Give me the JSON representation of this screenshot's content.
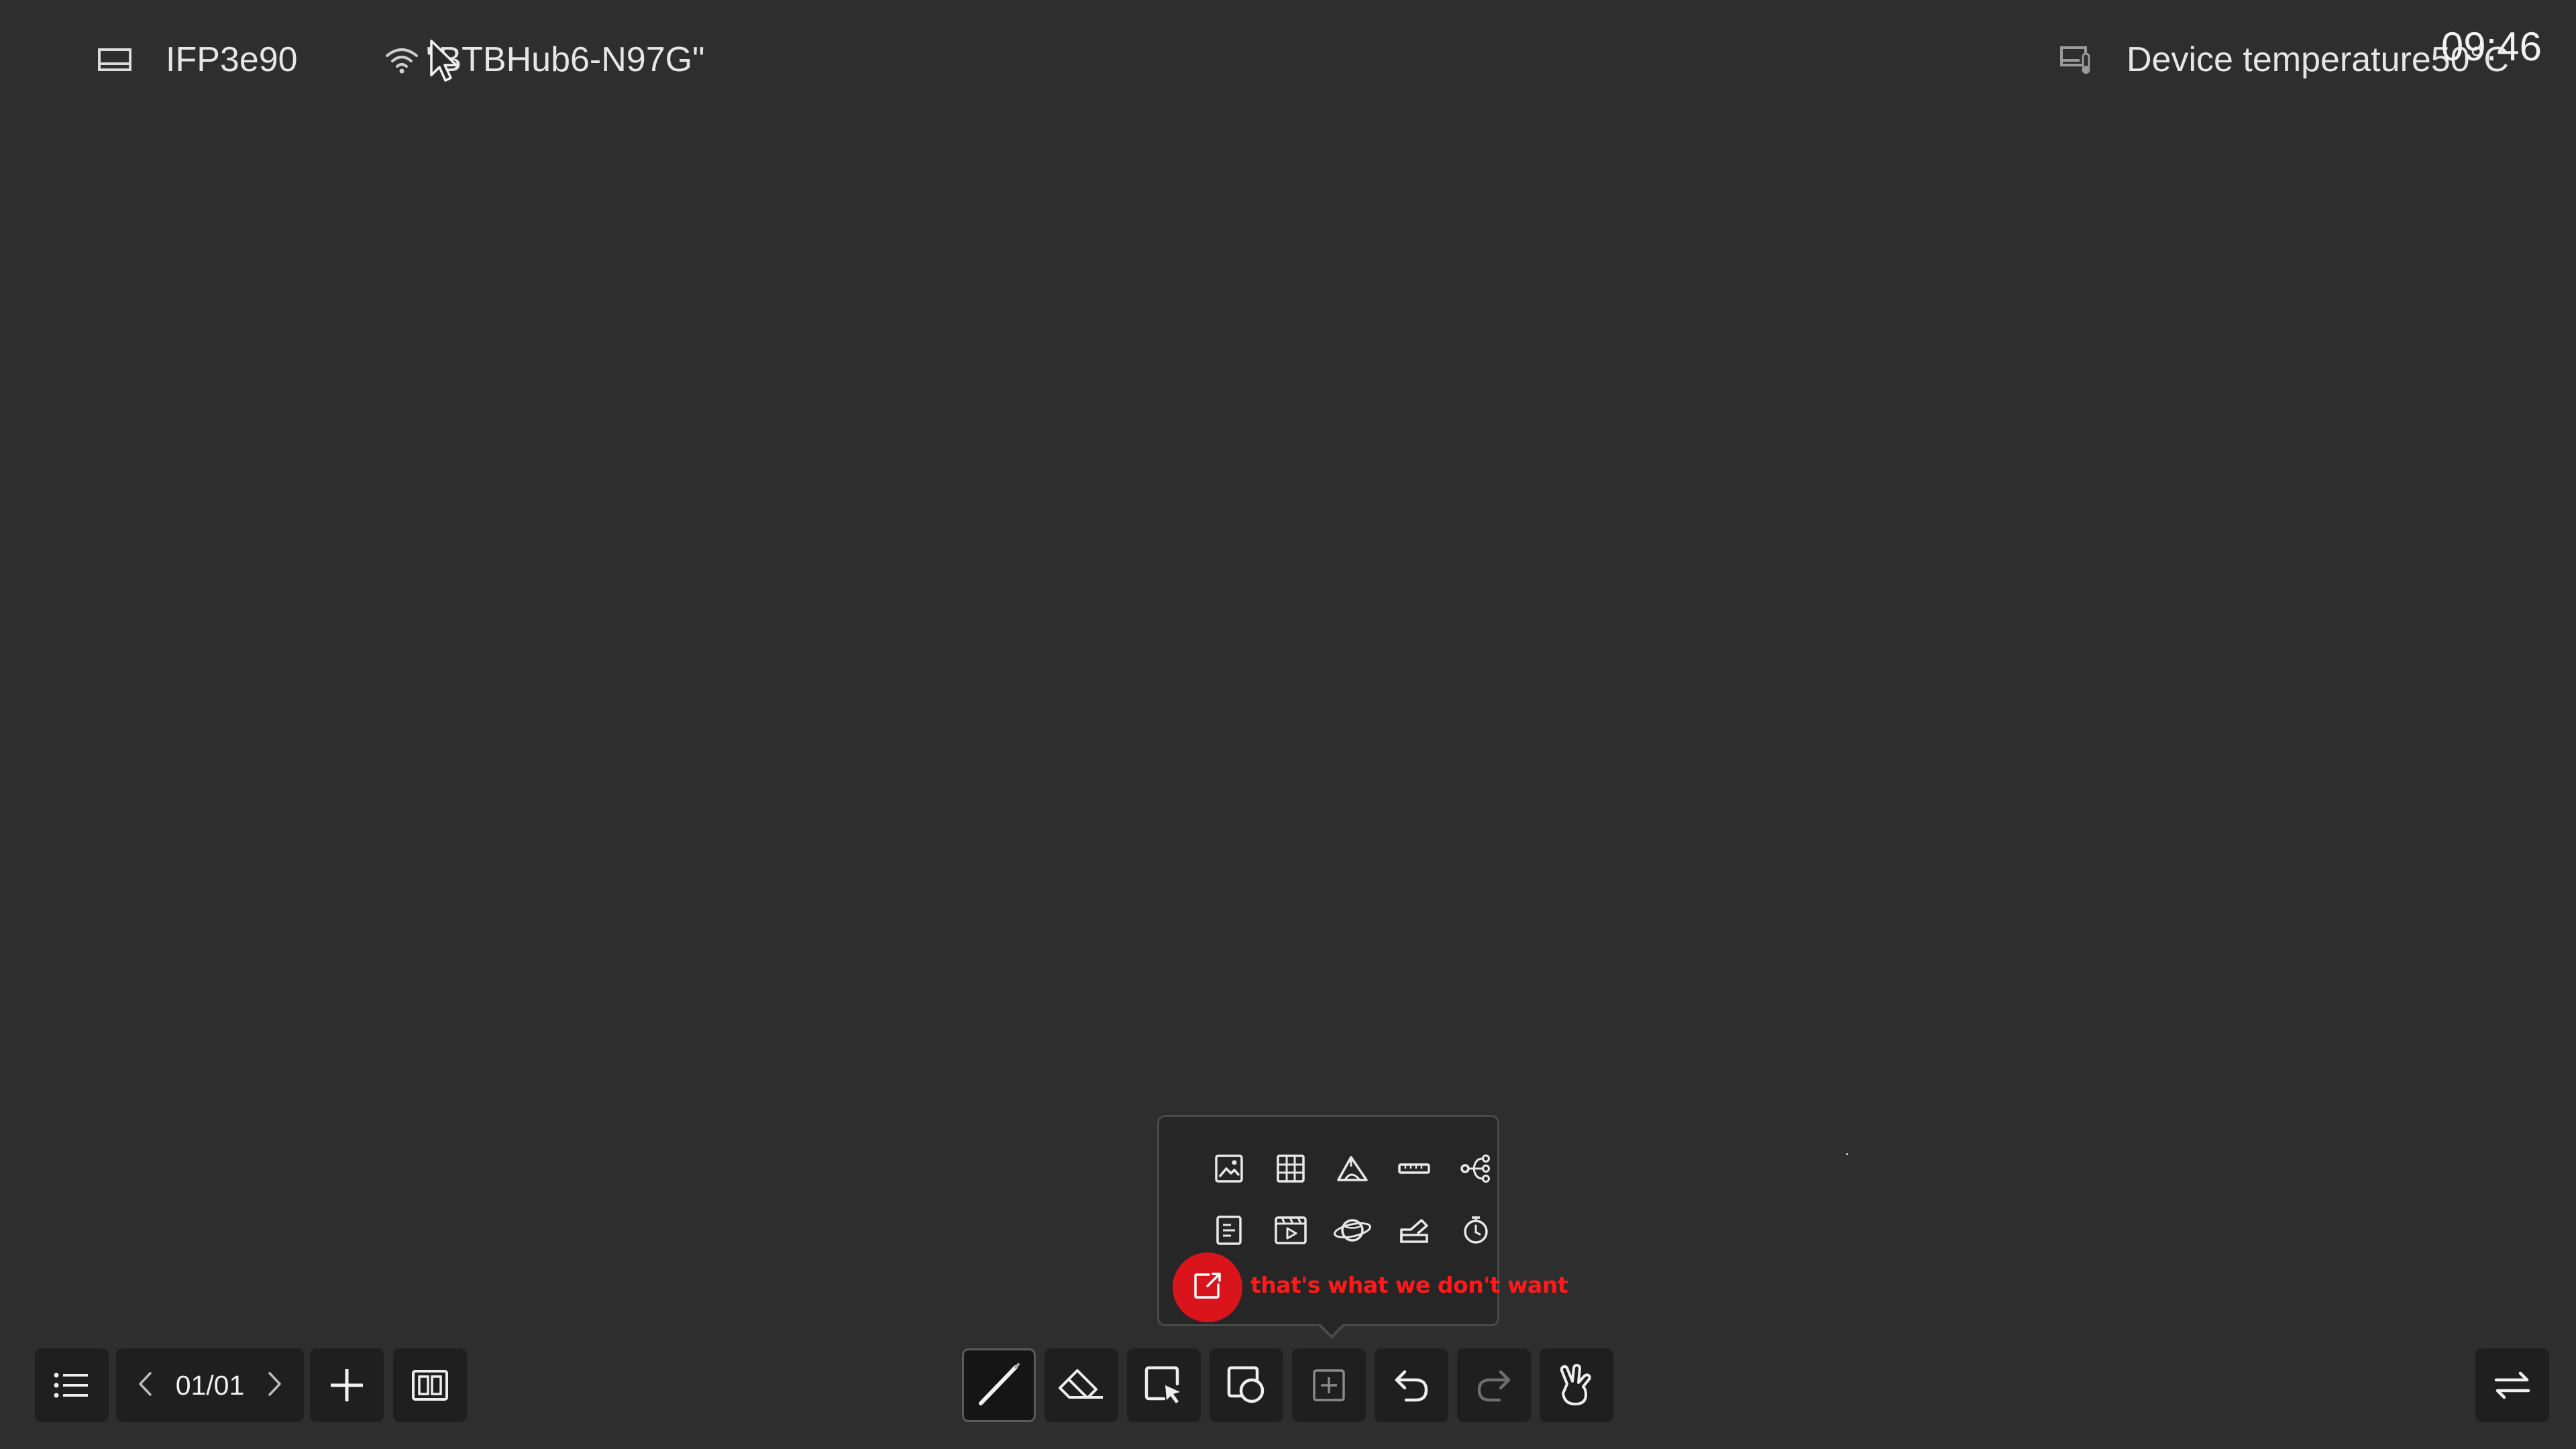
{
  "status_bar": {
    "device_icon": "display-icon",
    "device_name": "IFP3e90",
    "wifi_icon": "wifi-icon",
    "network_name": "\"BTBHub6-N97G\"",
    "temperature_icon": "device-temperature-icon",
    "temperature_label": "Device temperature50°C",
    "clock": "09:46"
  },
  "tools_popup": {
    "row1": [
      "image-icon",
      "table-icon",
      "math-formula-icon",
      "ruler-icon",
      "mind-map-icon"
    ],
    "row2": [
      "notes-icon",
      "video-icon",
      "browser-globe-icon",
      "education-icon",
      "timer-icon"
    ],
    "row3": [
      "export-share-icon"
    ],
    "annotation": "that's what we don't want",
    "annotation_color": "#ff1a1a"
  },
  "bottom_left": {
    "menu_icon": "list-menu-icon",
    "prev_icon": "chevron-left-icon",
    "page_counter": "01/01",
    "next_icon": "chevron-right-icon",
    "add_icon": "plus-icon",
    "overview_icon": "page-overview-icon"
  },
  "bottom_center": {
    "tools": [
      "pen-icon",
      "eraser-icon",
      "select-icon",
      "shapes-icon",
      "more-tools-icon",
      "undo-icon",
      "redo-icon",
      "gesture-icon"
    ],
    "active_tool": "pen-icon"
  },
  "bottom_right": {
    "switch_icon": "switch-sides-icon"
  },
  "colors": {
    "background": "#2e2e2e",
    "toolbar_button": "#1f1f1f",
    "highlight": "#d9141a"
  }
}
